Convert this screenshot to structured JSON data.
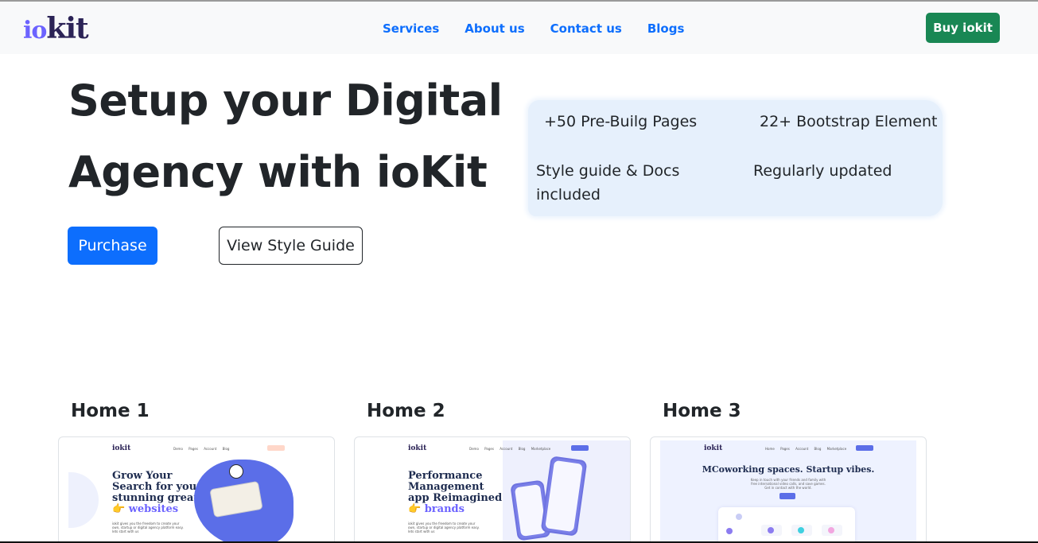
{
  "brand": {
    "logo_part1": "io",
    "logo_part2": "kit"
  },
  "nav": {
    "links": [
      "Services",
      "About us",
      "Contact us",
      "Blogs"
    ],
    "buy_label": "Buy iokit"
  },
  "hero": {
    "title_line1": "Setup your Digital",
    "title_line2": "Agency with ioKit",
    "purchase_label": "Purchase",
    "style_guide_label": "View Style Guide"
  },
  "features": [
    "+50 Pre-Builg Pages",
    "22+ Bootstrap Element",
    "Style guide & Docs included",
    "Regularly updated"
  ],
  "homes": [
    {
      "label": "Home 1",
      "preview": {
        "logo": "iokit",
        "nav": "Demo  Pages  Account  Blog",
        "heading_lines": [
          "Grow Your",
          "Search for your",
          "stunning great"
        ],
        "heading_accent": "👉 websites",
        "body": "iokit gives you the freedom to create your own, startup or digital agency platform easy. lets start with us"
      }
    },
    {
      "label": "Home 2",
      "preview": {
        "logo": "iokit",
        "nav": "Demo  Pages  Account  Blog  Marketplace",
        "heading_lines": [
          "Performance",
          "Management",
          "app Reimagined"
        ],
        "heading_accent": "👉 brands",
        "body": "iokit gives you the freedom to create your own, startup or digital agency platform easy. lets start with us"
      }
    },
    {
      "label": "Home 3",
      "preview": {
        "logo": "iokit",
        "nav": "Home  Pages  Account  Blog  Marketplace",
        "heading": "MCoworking spaces. Startup vibes.",
        "body": "Keep in touch with your friends and family with free international video calls, and save games. Get in contact with the world."
      }
    }
  ],
  "colors": {
    "primary": "#0d6efd",
    "success": "#198754",
    "feature_bg": "#e6f0fc",
    "preview_accent": "#6c63ff"
  }
}
